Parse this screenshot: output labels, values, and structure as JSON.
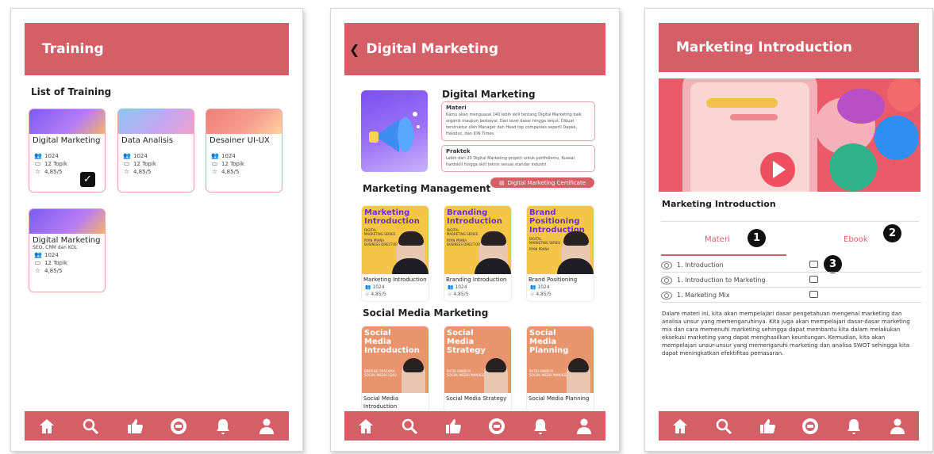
{
  "screen1": {
    "header_title": "Training",
    "section_title": "List of Training",
    "cards": [
      {
        "title": "Digital Marketing",
        "subtitle": "",
        "participants": "1024",
        "topics": "12 Topik",
        "rating": "4,85/5",
        "checked": true
      },
      {
        "title": "Data Analisis",
        "subtitle": "",
        "participants": "1024",
        "topics": "12 Topik",
        "rating": "4,85/5",
        "checked": false
      },
      {
        "title": "Desainer UI-UX",
        "subtitle": "",
        "participants": "1024",
        "topics": "12 Topik",
        "rating": "4,85/5",
        "checked": false
      },
      {
        "title": "Digital Marketing",
        "subtitle": "SEO, CRM dan KOL",
        "participants": "1024",
        "topics": "12 Topik",
        "rating": "4,85/5",
        "checked": false
      }
    ]
  },
  "screen2": {
    "header_title": "Digital Marketing",
    "course_title": "Digital Marketing",
    "materi": {
      "title": "Materi",
      "body": "Kamu akan menguasai 140 lebih skill tentang Digital Marketing baik organik maupun berbayar. Dari level dasar hingga lanjut. Dibuat terstruktur oleh Manager dan Head top companies seperti Dapek, Haloduc, dan IDN Times."
    },
    "praktek": {
      "title": "Praktek",
      "body": "Lebih dari 20 Digital Marketing project untuk portfoliomu. Kuasai hardskill hingga skill teknis sesuai standar industri."
    },
    "certificate_label": "Digital Marketing Certificate",
    "section1_title": "Marketing Management",
    "section1_modules": [
      {
        "cover": "Marketing Introduction",
        "tagline": "DIGITAL MARKETING SERIES",
        "presenter": "RYAN PRANA",
        "role": "BUSINESS DIRECTOR",
        "name": "Marketing Introduction",
        "participants": "1024",
        "rating": "4,85/5"
      },
      {
        "cover": "Branding Introduction",
        "tagline": "DIGITAL MARKETING SERIES",
        "presenter": "RYAN PRANA",
        "role": "BUSINESS DIRECTOR",
        "name": "Branding Introduction",
        "participants": "1024",
        "rating": "4,85/5"
      },
      {
        "cover": "Brand Positioning Introduction",
        "tagline": "DIGITAL MARKETING SERIES",
        "presenter": "RYAN PRANA",
        "role": "BUSINESS DIRECTOR",
        "name": "Brand Positioning",
        "participants": "1024",
        "rating": "4,85/5"
      }
    ],
    "section2_title": "Social Media Marketing",
    "section2_modules": [
      {
        "cover": "Social Media Introduction",
        "presenter": "BINTANG PRASAMA",
        "role": "SOCIAL MEDIA LEAD",
        "name": "Social Media Introduction"
      },
      {
        "cover": "Social Media Strategy",
        "presenter": "PUTRI ANNISYA",
        "role": "SOCIAL MEDIA MANAGER",
        "name": "Social Media Strategy"
      },
      {
        "cover": "Social Media Planning",
        "presenter": "PUTRI ANNISYA",
        "role": "SOCIAL MEDIA MANAGER",
        "name": "Social Media Planning"
      }
    ]
  },
  "screen3": {
    "header_title": "Marketing Introduction",
    "section_title": "Marketing Introduction",
    "tabs": [
      "Materi",
      "Ebook"
    ],
    "markers": [
      "1",
      "2",
      "3"
    ],
    "lessons": [
      "1. Introduction",
      "1. Introduction to Marketing",
      "1. Marketing Mix"
    ],
    "description": "Dalam materi ini, kita akan mempelajari dasar pengetahuan mengenai marketing dan analisa unsur yang memengaruhinya. Kita juga akan mempelajari dasar-dasar marketing mix dan cara memenuhi marketing sehingga dapat membantu kita dalam melakukan eksekusi marketing yang dapat menghasilkan keuntungan. Kemudian, kita akan mempelajari unsur-unsur yang memengaruhi marketing dan analisa SWOT sehingga kita dapat meningkatkan efektifitas pemasaran."
  },
  "nav_icons": [
    "home-icon",
    "search-icon",
    "thumbs-up-icon",
    "training-badge-icon",
    "bell-icon",
    "user-icon"
  ],
  "colors": {
    "accent": "#d55f67",
    "card_border": "#e6a7ab",
    "text": "#222222"
  }
}
